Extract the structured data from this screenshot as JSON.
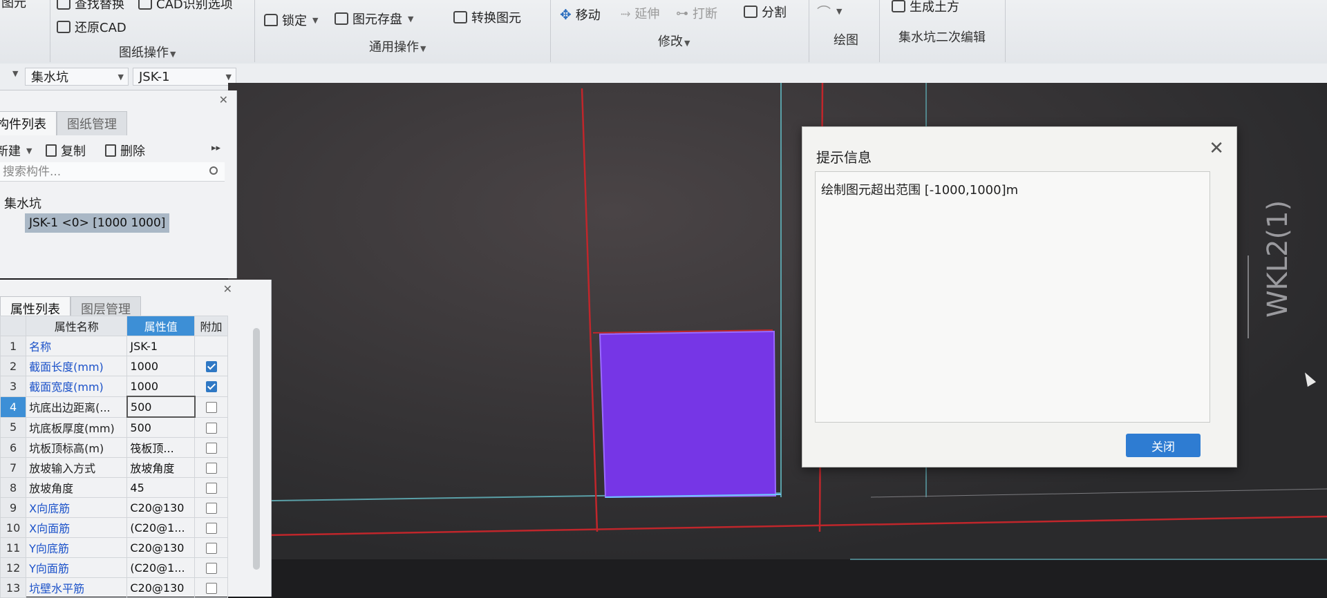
{
  "ribbon": {
    "find_replace": "查找替换",
    "cad_identify": "CAD识别选项",
    "restore_cad": "还原CAD",
    "drawing_ops": "图纸操作",
    "lock": "锁定",
    "element_save": "图元存盘",
    "convert_element": "转换图元",
    "general_ops": "通用操作",
    "move": "移动",
    "extend": "延伸",
    "break": "打断",
    "split": "分割",
    "modify": "修改",
    "draw": "绘图",
    "gen_earthwork": "生成土方",
    "pit_edit": "集水坑二次编辑",
    "partial_left": "图元"
  },
  "selectors": {
    "category": "集水坑",
    "component": "JSK-1"
  },
  "component_panel": {
    "tabs": [
      "构件列表",
      "图纸管理"
    ],
    "new": "新建",
    "copy": "复制",
    "delete": "删除",
    "search_placeholder": "搜索构件...",
    "tree_root": "集水坑",
    "tree_item": "JSK-1 <0> [1000 1000]"
  },
  "property_panel": {
    "tabs": [
      "属性列表",
      "图层管理"
    ],
    "headers": [
      "属性名称",
      "属性值",
      "附加"
    ],
    "rows": [
      {
        "n": "1",
        "name": "名称",
        "value": "JSK-1",
        "check": null,
        "blue": true
      },
      {
        "n": "2",
        "name": "截面长度(mm)",
        "value": "1000",
        "check": true,
        "blue": true
      },
      {
        "n": "3",
        "name": "截面宽度(mm)",
        "value": "1000",
        "check": true,
        "blue": true
      },
      {
        "n": "4",
        "name": "坑底出边距离(...",
        "value": "500",
        "check": false,
        "blue": false
      },
      {
        "n": "5",
        "name": "坑底板厚度(mm)",
        "value": "500",
        "check": false,
        "blue": false
      },
      {
        "n": "6",
        "name": "坑板顶标高(m)",
        "value": "筏板顶...",
        "check": false,
        "blue": false
      },
      {
        "n": "7",
        "name": "放坡输入方式",
        "value": "放坡角度",
        "check": false,
        "blue": false
      },
      {
        "n": "8",
        "name": "放坡角度",
        "value": "45",
        "check": false,
        "blue": false
      },
      {
        "n": "9",
        "name": "X向底筋",
        "value": "C20@130",
        "check": false,
        "blue": true
      },
      {
        "n": "10",
        "name": "X向面筋",
        "value": "(C20@1...",
        "check": false,
        "blue": true
      },
      {
        "n": "11",
        "name": "Y向底筋",
        "value": "C20@130",
        "check": false,
        "blue": true
      },
      {
        "n": "12",
        "name": "Y向面筋",
        "value": "(C20@1...",
        "check": false,
        "blue": true
      },
      {
        "n": "13",
        "name": "坑壁水平筋",
        "value": "C20@130",
        "check": false,
        "blue": true
      }
    ]
  },
  "canvas": {
    "beam_label": "WKL2(1)"
  },
  "dialog": {
    "title": "提示信息",
    "message": "绘制图元超出范围 [-1000,1000]m",
    "close_label": "关闭"
  }
}
